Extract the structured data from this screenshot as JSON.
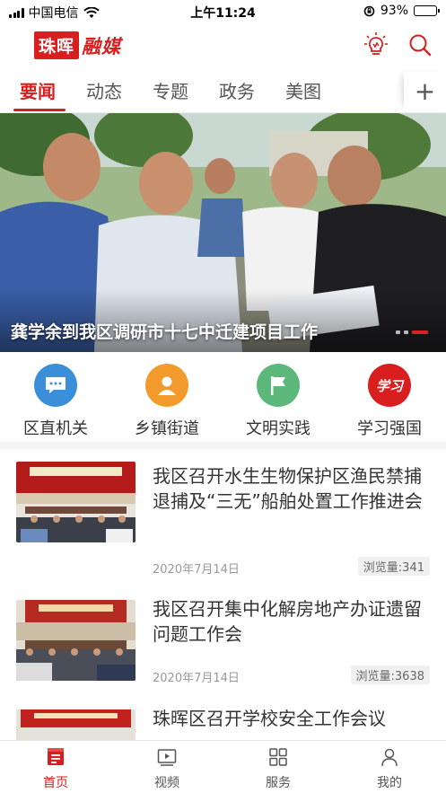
{
  "status_bar": {
    "carrier": "中国电信",
    "time": "上午11:24",
    "battery_pct": "93%",
    "battery_level": 0.93
  },
  "header": {
    "logo_seal": "珠晖",
    "logo_script": "融媒",
    "bulb_icon": "lightbulb-icon",
    "search_icon": "search-icon"
  },
  "tabs": [
    {
      "label": "要闻",
      "active": true
    },
    {
      "label": "动态"
    },
    {
      "label": "专题"
    },
    {
      "label": "政务"
    },
    {
      "label": "美图"
    }
  ],
  "tab_add": "+",
  "banner": {
    "caption": "龚学余到我区调研市十七中迁建项目工作",
    "slide_count": 3,
    "active_slide": 3
  },
  "quick_links": [
    {
      "label": "区直机关",
      "icon": "chat-bubble-icon",
      "color": "#3b8fd9"
    },
    {
      "label": "乡镇街道",
      "icon": "person-icon",
      "color": "#f39a2d"
    },
    {
      "label": "文明实践",
      "icon": "flag-icon",
      "color": "#5cb87a"
    },
    {
      "label": "学习强国",
      "icon": "xuexi-logo-icon",
      "color": "#d81e1e",
      "logo_text": "学习"
    }
  ],
  "news": [
    {
      "title": "我区召开水生生物保护区渔民禁捕退捕及“三无”船舶处置工作推进会",
      "date": "2020年7月14日",
      "views": "浏览量:341"
    },
    {
      "title": "我区召开集中化解房地产办证遗留问题工作会",
      "date": "2020年7月14日",
      "views": "浏览量:3638"
    },
    {
      "title": "珠晖区召开学校安全工作会议",
      "date": "",
      "views": ""
    }
  ],
  "bottom_nav": [
    {
      "label": "首页",
      "icon": "home-icon",
      "active": true
    },
    {
      "label": "视频",
      "icon": "video-icon"
    },
    {
      "label": "服务",
      "icon": "grid-icon"
    },
    {
      "label": "我的",
      "icon": "user-icon"
    }
  ],
  "colors": {
    "accent": "#d81e1e"
  }
}
